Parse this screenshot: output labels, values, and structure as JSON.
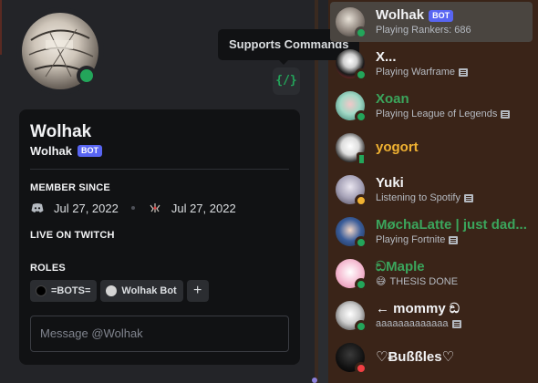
{
  "tooltip": "Supports Commands",
  "profile": {
    "display_name": "Wolhak",
    "username": "Wolhak",
    "bot_tag": "BOT",
    "member_since_heading": "MEMBER SINCE",
    "discord_join_date": "Jul 27, 2022",
    "server_join_date": "Jul 27, 2022",
    "live_heading": "LIVE ON TWITCH",
    "roles_heading": "ROLES",
    "roles": [
      {
        "name": "=BOTS=",
        "color": "#000000"
      },
      {
        "name": "Wolhak Bot",
        "color": "#d4d4d4"
      }
    ],
    "add_role": "+",
    "message_placeholder": "Message @Wolhak",
    "status_color": "#23a55a",
    "command_icon": "{/}"
  },
  "members": [
    {
      "name": "Wolhak",
      "bot_tag": "BOT",
      "activity": "Playing Rankers: 686",
      "name_color": "#f2f3f5",
      "status": "online",
      "active": true
    },
    {
      "name": "X...",
      "activity": "Playing Warframe",
      "name_color": "#f2f3f5",
      "status": "online",
      "icon": "rich-presence-icon"
    },
    {
      "name": "Xoan",
      "activity": "Playing League of Legends",
      "name_color": "#3ba55c",
      "status": "online",
      "icon": "rich-presence-icon"
    },
    {
      "name": "yogort",
      "activity": "",
      "name_color": "#f0b232",
      "status": "mobile"
    },
    {
      "name": "Yuki",
      "activity": "Listening to Spotify",
      "name_color": "#f2f3f5",
      "status": "idle",
      "icon": "rich-presence-icon"
    },
    {
      "name": "MøchaLatte | just dad...",
      "activity": "Playing Fortnite",
      "name_color": "#3ba55c",
      "status": "online",
      "icon": "rich-presence-icon"
    },
    {
      "name": "ඞMaple",
      "activity": "THESIS DONE",
      "name_color": "#3ba55c",
      "status": "online",
      "emoji": "😅"
    },
    {
      "name": "← mommy ඞ",
      "activity": "aaaaaaaaaaaaa",
      "name_color": "#f2f3f5",
      "status": "online",
      "icon": "rich-presence-icon"
    },
    {
      "name": "♡Ƀußßles♡",
      "activity": "",
      "name_color": "#f2f3f5",
      "status": "dnd"
    }
  ]
}
